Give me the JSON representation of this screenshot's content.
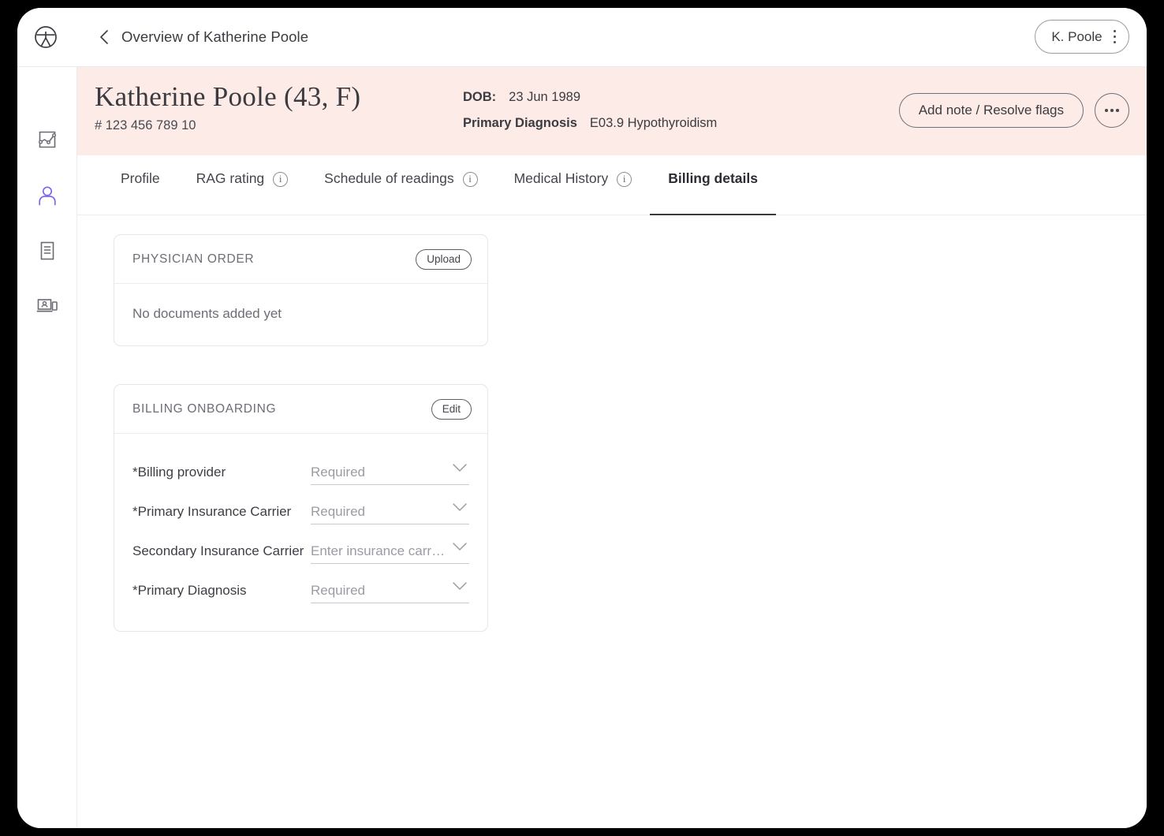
{
  "topbar": {
    "logo_icon": "circle-person-logo-icon",
    "back_icon": "chevron-left-icon",
    "breadcrumb": "Overview of Katherine Poole",
    "user_chip": {
      "label": "K. Poole",
      "menu_icon": "vertical-dots-icon"
    }
  },
  "sidebar": {
    "items": [
      {
        "icon": "analytics-chart-icon",
        "name": "sidebar-item-analytics",
        "active": false
      },
      {
        "icon": "person-icon",
        "name": "sidebar-item-patients",
        "active": true
      },
      {
        "icon": "document-icon",
        "name": "sidebar-item-documents",
        "active": false
      },
      {
        "icon": "telehealth-monitor-icon",
        "name": "sidebar-item-telehealth",
        "active": false
      }
    ],
    "active_color": "#7b68ee",
    "inactive_color": "#6b6b73"
  },
  "banner": {
    "background": "#fcebe6",
    "patient_name": "Katherine Poole (43, F)",
    "patient_id": "# 123 456 789 10",
    "meta": [
      {
        "key": "DOB:",
        "value": "23 Jun 1989"
      },
      {
        "key": "Primary Diagnosis",
        "value": "E03.9 Hypothyroidism"
      }
    ],
    "add_note_label": "Add note / Resolve flags",
    "more_icon": "horizontal-dots-icon"
  },
  "tabs": [
    {
      "label": "Profile",
      "info": false,
      "active": false
    },
    {
      "label": "RAG rating",
      "info": true,
      "active": false
    },
    {
      "label": "Schedule of readings",
      "info": true,
      "active": false
    },
    {
      "label": "Medical History",
      "info": true,
      "active": false
    },
    {
      "label": "Billing details",
      "info": false,
      "active": true
    }
  ],
  "cards": {
    "physician_order": {
      "title": "PHYSICIAN ORDER",
      "action_label": "Upload",
      "empty_text": "No documents added yet"
    },
    "billing_onboarding": {
      "title": "BILLING ONBOARDING",
      "action_label": "Edit",
      "fields": [
        {
          "label": "*Billing provider",
          "placeholder": "Required",
          "value": ""
        },
        {
          "label": "*Primary Insurance Carrier",
          "placeholder": "Required",
          "value": ""
        },
        {
          "label": "Secondary Insurance Carrier",
          "placeholder": "Enter insurance carr…",
          "value": ""
        },
        {
          "label": "*Primary Diagnosis",
          "placeholder": "Required",
          "value": ""
        }
      ]
    }
  }
}
